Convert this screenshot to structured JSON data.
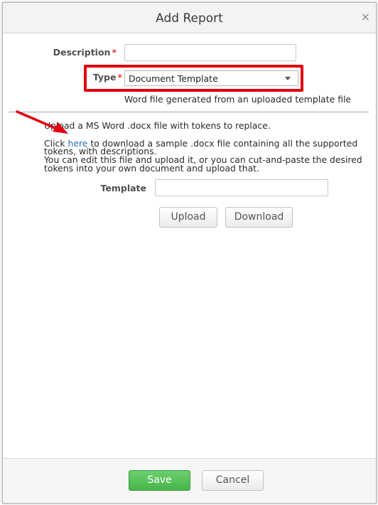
{
  "dialog": {
    "title": "Add Report",
    "close_glyph": "×"
  },
  "form": {
    "description_label": "Description",
    "required_marker": "*",
    "type_label": "Type",
    "type_value": "Document Template",
    "type_hint": "Word file generated from an uploaded template file",
    "template_label": "Template"
  },
  "instructions": {
    "line1": "Upload a MS Word .docx file with tokens to replace.",
    "line2_prefix": "Click ",
    "line2_link": "here",
    "line2_suffix": " to download a sample .docx file containing all the supported",
    "line3": "tokens, with descriptions.",
    "line4": "You can edit this file and upload it, or you can cut-and-paste the desired",
    "line5": "tokens into your own document and upload that."
  },
  "buttons": {
    "upload": "Upload",
    "download": "Download",
    "save": "Save",
    "cancel": "Cancel"
  },
  "annotations": {
    "highlight_color": "#e0000f",
    "arrow_color": "#e0000f"
  },
  "icons": {
    "close": "close-icon",
    "dropdown": "chevron-down-icon",
    "annotation_arrow": "arrow-icon"
  }
}
